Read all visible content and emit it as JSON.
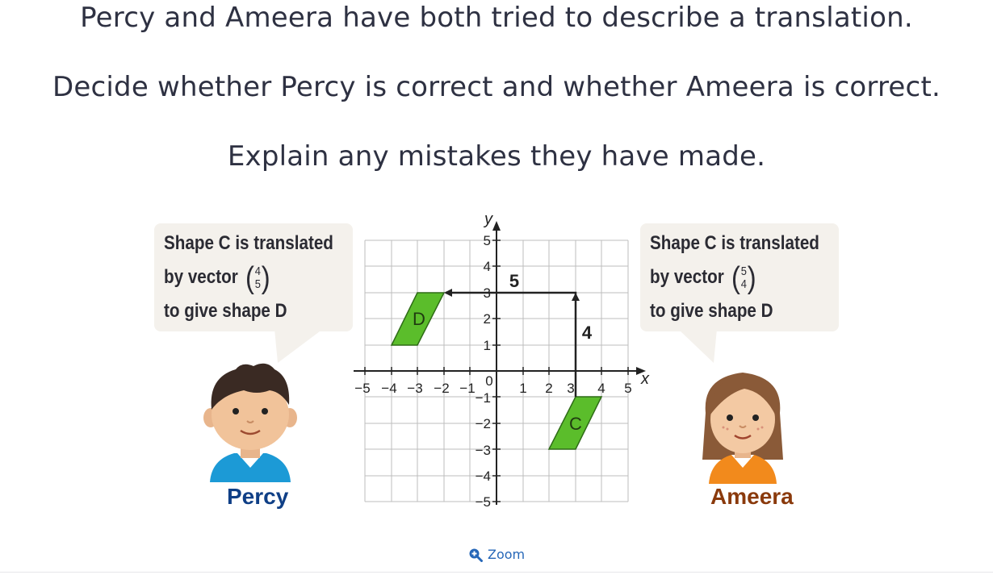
{
  "question": {
    "line1": "Percy and Ameera have both tried to describe a translation.",
    "line2": "Decide whether Percy is correct and whether Ameera is correct.",
    "line3": "Explain any mistakes they have made."
  },
  "percy": {
    "bubble_line1": "Shape C is translated",
    "bubble_prefix": "by vector",
    "vector_top": "4",
    "vector_bottom": "5",
    "bubble_line3": "to give shape D",
    "name": "Percy",
    "name_color": "#0f3f86"
  },
  "ameera": {
    "bubble_line1": "Shape C is translated",
    "bubble_prefix": "by vector",
    "vector_top": "5",
    "vector_bottom": "4",
    "bubble_line3": "to give shape D",
    "name": "Ameera",
    "name_color": "#8a3a0c"
  },
  "graph": {
    "x_axis_label": "x",
    "y_axis_label": "y",
    "x_ticks": [
      "−5",
      "−4",
      "−3",
      "−2",
      "−1",
      "1",
      "2",
      "3",
      "4",
      "5"
    ],
    "y_ticks_pos": [
      "5",
      "4",
      "3",
      "2",
      "1"
    ],
    "y_ticks_neg": [
      "−1",
      "−2",
      "−3",
      "−4",
      "−5"
    ],
    "origin_label": "0",
    "shape_c_label": "C",
    "shape_d_label": "D",
    "horizontal_step_label": "5",
    "vertical_step_label": "4",
    "shape_fill": "#5bbd2b"
  },
  "zoom_label": "Zoom"
}
